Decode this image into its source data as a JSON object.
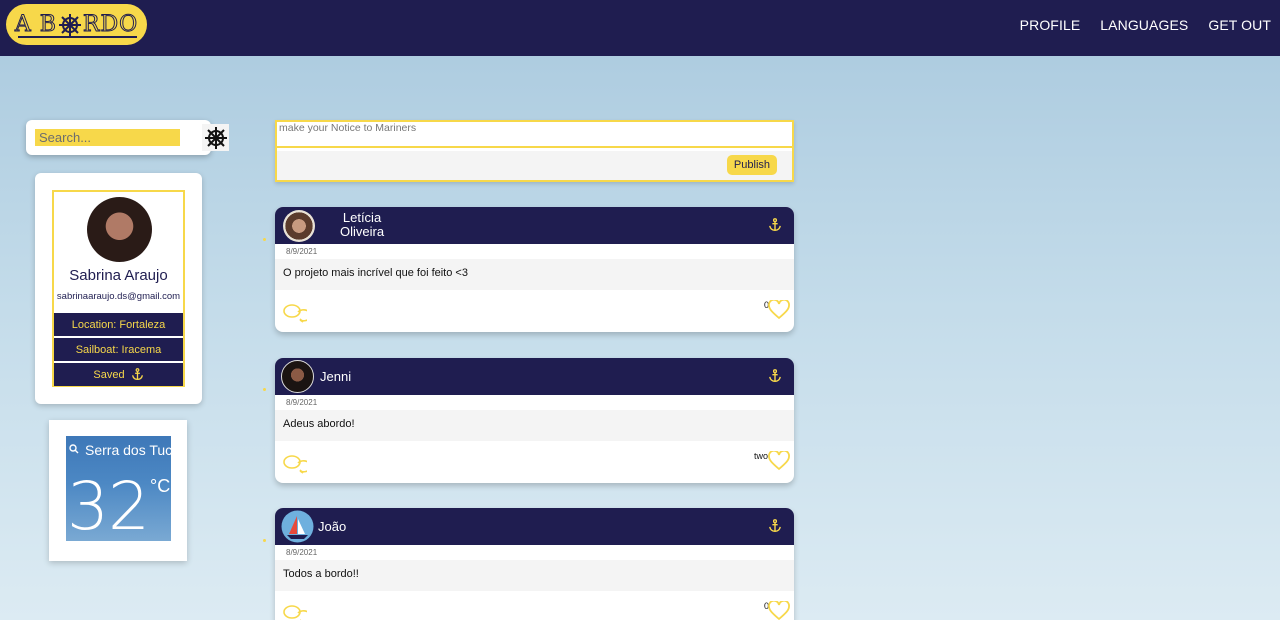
{
  "header": {
    "logo_text": "ABORDO",
    "logo_left": "A B",
    "logo_right": "RDO",
    "nav": [
      "PROFILE",
      "LANGUAGES",
      "GET OUT"
    ]
  },
  "search": {
    "placeholder": "Search..."
  },
  "profile": {
    "name": "Sabrina Araujo",
    "email": "sabrinaaraujo.ds@gmail.com",
    "location": "Location: Fortaleza",
    "sailboat": "Sailboat: Iracema",
    "saved": "Saved"
  },
  "weather": {
    "city": "Serra dos Tuc",
    "temp": "32",
    "unit": "°C"
  },
  "compose": {
    "placeholder": "make your Notice to Mariners",
    "publish": "Publish"
  },
  "posts": [
    {
      "author_first": "Letícia",
      "author_last": "Oliveira",
      "date": "8/9/2021",
      "text": "O projeto mais incrível que foi feito <3",
      "likes": "0"
    },
    {
      "author": "Jenni",
      "date": "8/9/2021",
      "text": "Adeus abordo!",
      "likes": "two"
    },
    {
      "author": "João",
      "date": "8/9/2021",
      "text": "Todos a bordo!!",
      "likes": "0"
    }
  ],
  "colors": {
    "navy": "#1f1d50",
    "yellow": "#f7d84a"
  }
}
